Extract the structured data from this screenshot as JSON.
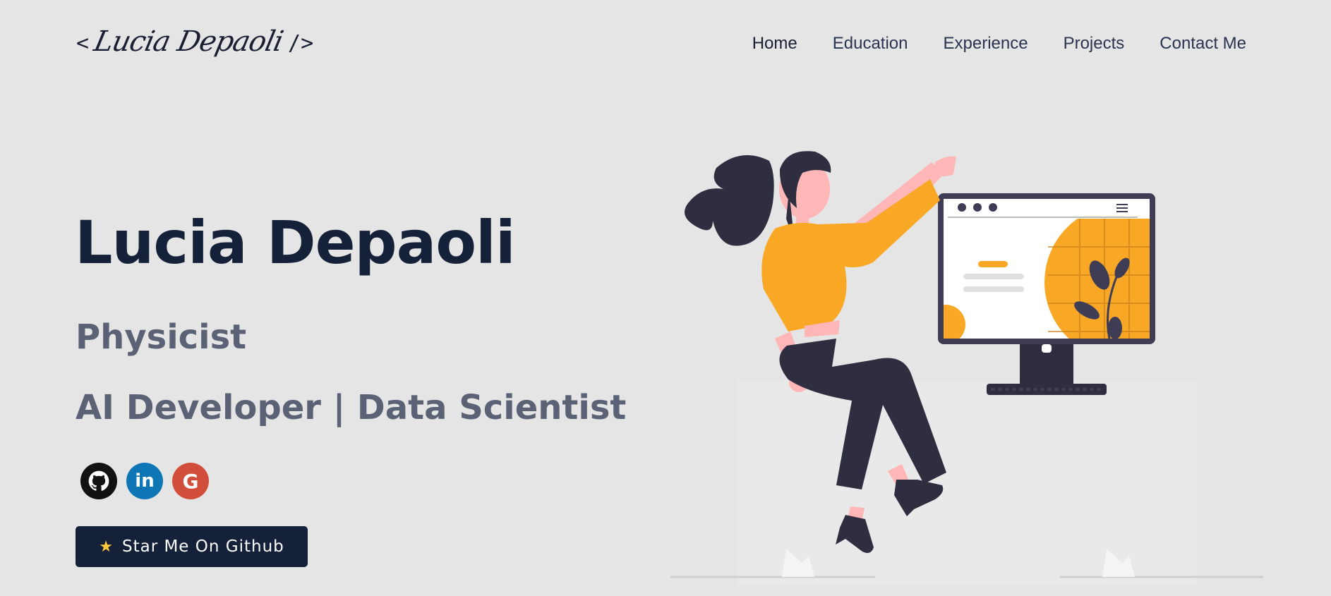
{
  "header": {
    "logo": {
      "open": "<",
      "name": "Lucia Depaoli",
      "close": "/>"
    },
    "nav": [
      {
        "label": "Home",
        "active": true
      },
      {
        "label": "Education",
        "active": false
      },
      {
        "label": "Experience",
        "active": false
      },
      {
        "label": "Projects",
        "active": false
      },
      {
        "label": "Contact Me",
        "active": false
      }
    ]
  },
  "hero": {
    "name": "Lucia Depaoli",
    "roles": [
      "Physicist",
      "AI Developer | Data Scientist"
    ],
    "socials": [
      {
        "name": "github",
        "icon": "github-icon",
        "color": "#121212"
      },
      {
        "name": "linkedin",
        "icon": "linkedin-icon",
        "color": "#0e76b5",
        "glyph": "in"
      },
      {
        "name": "google",
        "icon": "google-icon",
        "color": "#d14f3a",
        "glyph": "G"
      }
    ],
    "cta": {
      "icon": "star-icon",
      "label": "Star Me On Github"
    }
  },
  "colors": {
    "background": "#e5e5e5",
    "primary": "#152039",
    "accent": "#f9a826",
    "muted_text": "#5b6276"
  }
}
